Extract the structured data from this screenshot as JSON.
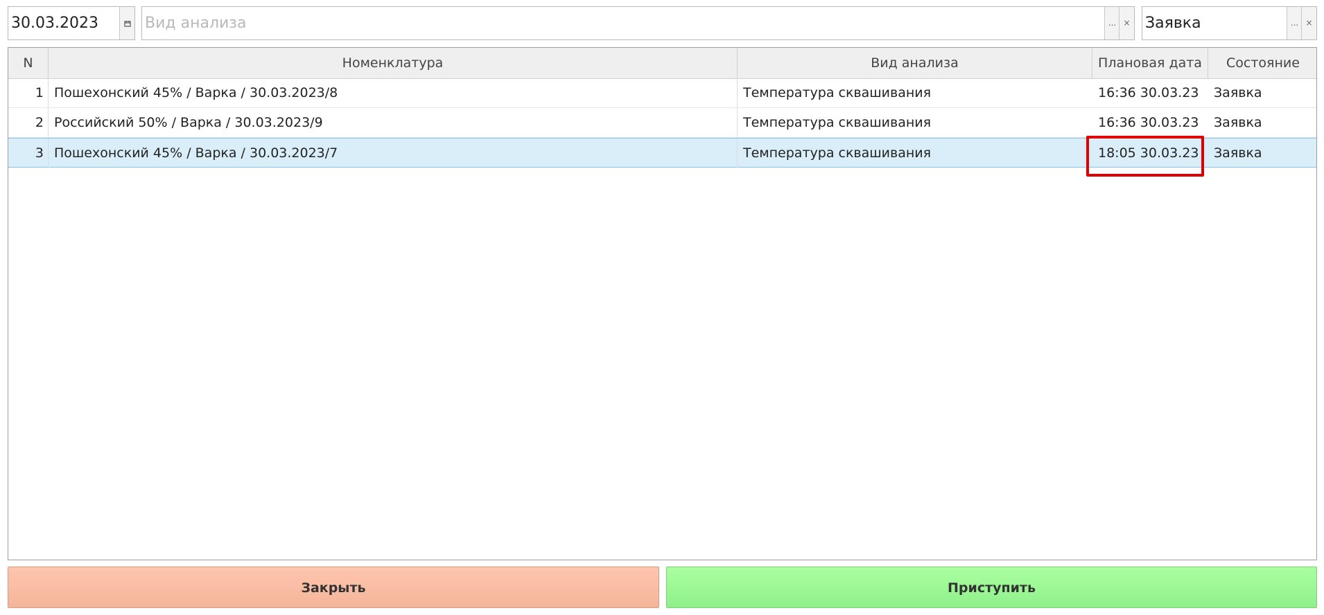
{
  "filters": {
    "date": {
      "value": "30.03.2023",
      "icon": "calendar-icon"
    },
    "analysis_type": {
      "value": "",
      "placeholder": "Вид анализа",
      "browse_label": "...",
      "clear_label": "×"
    },
    "status": {
      "value": "Заявка",
      "browse_label": "...",
      "clear_label": "×"
    }
  },
  "table": {
    "columns": {
      "n": "N",
      "nomenclature": "Номенклатура",
      "analysis_type": "Вид анализа",
      "planned_date": "Плановая дата",
      "state": "Состояние"
    },
    "rows": [
      {
        "n": "1",
        "nomenclature": "Пошехонский 45% / Варка / 30.03.2023/8",
        "analysis_type": "Температура сквашивания",
        "planned_date": "16:36 30.03.23",
        "state": "Заявка"
      },
      {
        "n": "2",
        "nomenclature": "Российский 50% / Варка / 30.03.2023/9",
        "analysis_type": "Температура сквашивания",
        "planned_date": "16:36 30.03.23",
        "state": "Заявка"
      },
      {
        "n": "3",
        "nomenclature": "Пошехонский 45% / Варка / 30.03.2023/7",
        "analysis_type": "Температура сквашивания",
        "planned_date": "18:05 30.03.23",
        "state": "Заявка"
      }
    ],
    "selected_row": 3
  },
  "buttons": {
    "close_label": "Закрыть",
    "start_label": "Приступить"
  },
  "colors": {
    "highlight": "#e10000",
    "selection": "#daeefa",
    "close_button": "#ffc6ad",
    "start_button": "#9ff897"
  }
}
